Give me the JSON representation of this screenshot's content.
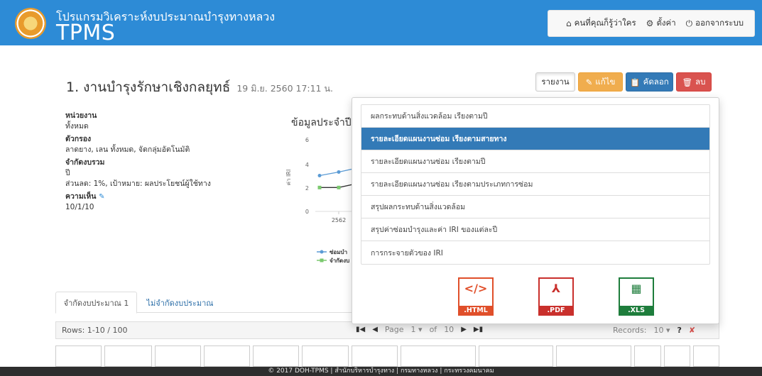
{
  "header": {
    "subtitle": "โปรแกรมวิเคราะห์งบประมาณบำรุงทางหลวง",
    "title": "TPMS",
    "user_label": "คนที่คุณก็รู้ว่าใคร",
    "settings_label": "ตั้งค่า",
    "logout_label": "ออกจากระบบ"
  },
  "page": {
    "title": "1. งานบำรุงรักษาเชิงกลยุทธ์",
    "timestamp": "19 มิ.ย. 2560 17:11 น."
  },
  "toolbar": {
    "report_label": "รายงาน",
    "edit_label": "แก้ไข",
    "copy_label": "คัดลอก",
    "delete_label": "ลบ"
  },
  "info": {
    "unit_label": "หน่วยงาน",
    "unit_value": "ทั้งหมด",
    "filter_label": "ตัวกรอง",
    "filter_value": "ลาดยาง, เลน ทั้งหมด, จัดกลุ่มอัตโนมัติ",
    "limit_label": "จำกัดงบรวม",
    "limit_value1": "ปี",
    "limit_value2": "ส่วนลด: 1%, เป้าหมาย: ผลประโยชน์ผู้ใช้ทาง",
    "comment_label": "ความเห็น",
    "comment_value": "10/1/10"
  },
  "chart_panel": {
    "title": "ข้อมูลประจำปี",
    "ylabel": "ค่า IRI",
    "y_ticks": [
      "6",
      "4",
      "2",
      "0"
    ],
    "x_tick": "2562",
    "legend": [
      "ซ่อมบำ",
      "จำกัดงบ"
    ]
  },
  "chart_data": {
    "type": "line",
    "ylabel": "ค่า IRI",
    "ylim": [
      0,
      6
    ],
    "categories": [
      "2562"
    ],
    "series": [
      {
        "name": "ซ่อมบำ",
        "values": [
          3.0,
          3.3,
          3.6
        ]
      },
      {
        "name": "จำกัดงบ",
        "values": [
          2.0,
          2.0,
          2.3
        ]
      }
    ]
  },
  "tabs": [
    "จำกัดงบประมาณ 1",
    "ไม่จำกัดงบประมาณ"
  ],
  "pager": {
    "rows_text": "Rows: 1-10 / 100",
    "page_label": "Page",
    "page_value": "1",
    "of_label": "of",
    "of_value": "10",
    "records_label": "Records:",
    "records_value": "10",
    "help": "?"
  },
  "report_menu": {
    "items": [
      "ผลกระทบด้านสิ่งแวดล้อม เรียงตามปี",
      "รายละเอียดแผนงานซ่อม เรียงตามสายทาง",
      "รายละเอียดแผนงานซ่อม เรียงตามปี",
      "รายละเอียดแผนงานซ่อม เรียงตามประเภทการซ่อม",
      "สรุปผลกระทบด้านสิ่งแวดล้อม",
      "สรุปค่าซ่อมบำรุงและค่า IRI ของแต่ละปี",
      "การกระจายตัวของ IRI"
    ],
    "active_index": 1,
    "exports": [
      {
        "glyph": "</>",
        "tag": ".HTML"
      },
      {
        "glyph": "⅄",
        "tag": ".PDF"
      },
      {
        "glyph": "▦",
        "tag": ".XLS"
      }
    ]
  },
  "footer": "© 2017 DOH-TPMS | สำนักบริหารบำรุงทาง | กรมทางหลวง | กระทรวงคมนาคม",
  "colors": {
    "header": "#2d8bd6",
    "series1": "#5b9bd5",
    "series2": "#7bc96f"
  }
}
